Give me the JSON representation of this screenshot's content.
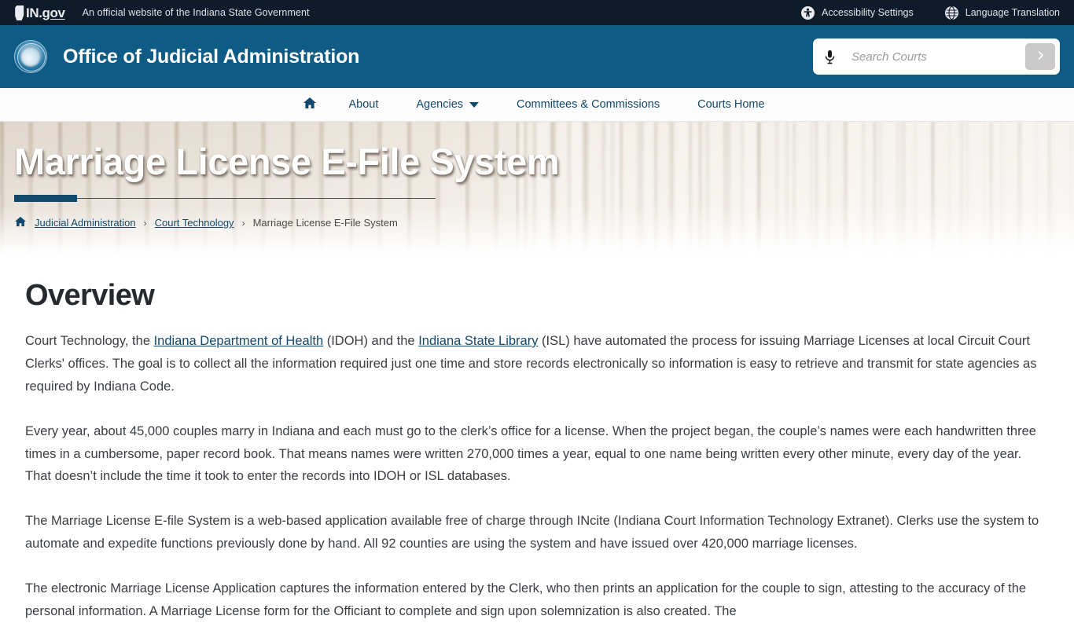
{
  "utility": {
    "logo_text_in": "IN",
    "logo_text_dot": ".",
    "logo_text_gov": "gov",
    "official_text": "An official website of the Indiana State Government",
    "accessibility_label": "Accessibility Settings",
    "language_label": "Language Translation",
    "accessibility_icon": "accessibility-icon",
    "language_icon": "globe-icon",
    "background_color": "#0d1b2a"
  },
  "masthead": {
    "site_title": "Office of Judicial Administration",
    "seal_icon": "state-seal-icon",
    "background_color": "#0e5c86",
    "search": {
      "placeholder": "Search Courts",
      "value": "",
      "mic_icon": "microphone-icon",
      "submit_icon": "chevron-right-icon",
      "submit_label": ""
    }
  },
  "nav": {
    "home_icon": "home-icon",
    "items": [
      {
        "label": "About",
        "has_caret": false
      },
      {
        "label": "Agencies",
        "has_caret": true
      },
      {
        "label": "Committees & Commissions",
        "has_caret": false
      },
      {
        "label": "Courts Home",
        "has_caret": false
      }
    ],
    "link_color": "#12486b"
  },
  "hero": {
    "title": "Marriage License E-File System",
    "accent_color": "#12486b",
    "breadcrumb": {
      "home_icon": "home-icon",
      "separator": "›",
      "items": [
        {
          "label": "Judicial Administration",
          "is_link": true
        },
        {
          "label": "Court Technology",
          "is_link": true
        },
        {
          "label": "Marriage License E-File System",
          "is_link": false
        }
      ]
    }
  },
  "main": {
    "section_title": "Overview",
    "paragraph1": {
      "part1": "Court Technology, the ",
      "link1": "Indiana Department of Health",
      "part2": " (IDOH) and the ",
      "link2": "Indiana State Library",
      "part3": " (ISL) have automated the process for issuing Marriage Licenses at local Circuit Court Clerks' offices. The goal is to collect all the information required just one time and store records electronically so information is easy to retrieve and transmit for state agencies as required by Indiana Code."
    },
    "paragraph2": "Every year, about 45,000 couples marry in Indiana and each must go to the clerk’s office for a license. When the project began, the couple’s names were each handwritten three times in a cumbersome, paper record book.  That means names were written 270,000 times a year, equal to one name being written every other minute, every day of the year. That doesn’t include the time it took to enter the records into IDOH or ISL databases.",
    "paragraph3": "The Marriage License E-file System is a web-based application available free of charge through INcite (Indiana Court Information Technology Extranet). Clerks use the system to automate and expedite functions previously done by hand. All 92 counties are using the system and have issued over 420,000 marriage licenses.",
    "paragraph4": "The electronic Marriage License Application captures the information entered by the Clerk, who then prints an application for the couple to sign, attesting to the accuracy of the personal information. A Marriage License form for the Officiant to complete and sign upon solemnization is also created. The"
  }
}
